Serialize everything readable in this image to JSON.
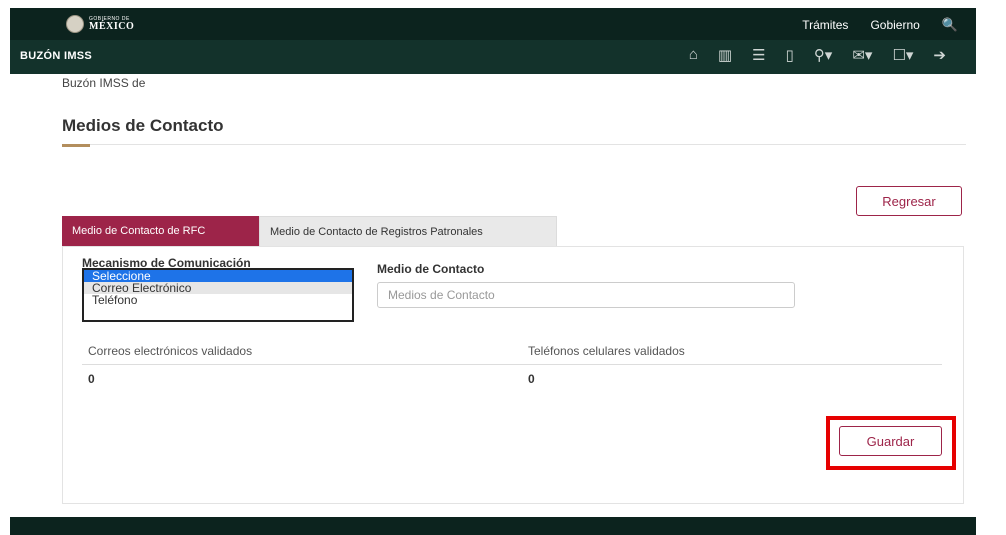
{
  "header": {
    "logo_small": "GOBIERNO DE",
    "logo_big": "MÉXICO",
    "nav": [
      "Trámites",
      "Gobierno"
    ],
    "search_icon": "🔍"
  },
  "subheader": {
    "title": "BUZÓN IMSS",
    "icons": [
      "home-icon",
      "building-icon",
      "document-icon",
      "mobile-icon",
      "user-dropdown-icon",
      "mail-dropdown-icon",
      "inbox-dropdown-icon",
      "logout-icon"
    ],
    "glyphs": [
      "⌂",
      "▥",
      "☰",
      "▯",
      "⚲▾",
      "✉▾",
      "☐▾",
      "➔"
    ]
  },
  "breadcrumb": "Buzón IMSS de",
  "page_title": "Medios de Contacto",
  "buttons": {
    "regresar": "Regresar",
    "guardar": "Guardar"
  },
  "tabs": [
    {
      "label": "Medio de Contacto de RFC",
      "active": true
    },
    {
      "label": "Medio de Contacto de Registros Patronales",
      "active": false
    }
  ],
  "form": {
    "mecanismo_label": "Mecanismo de Comunicación",
    "mecanismo_options": [
      "Seleccione",
      "Correo Electrónico",
      "Teléfono"
    ],
    "mecanismo_selected": "Seleccione",
    "medio_label": "Medio de Contacto",
    "medio_placeholder": "Medios de Contacto",
    "medio_value": ""
  },
  "summary": {
    "correos_label": "Correos electrónicos validados",
    "correos_count": "0",
    "telefonos_label": "Teléfonos celulares validados",
    "telefonos_count": "0"
  },
  "colors": {
    "header_bg": "#0c231e",
    "subheader_bg": "#13322b",
    "accent": "#9d2449",
    "gold": "#b38e5d",
    "highlight": "#e60000"
  }
}
